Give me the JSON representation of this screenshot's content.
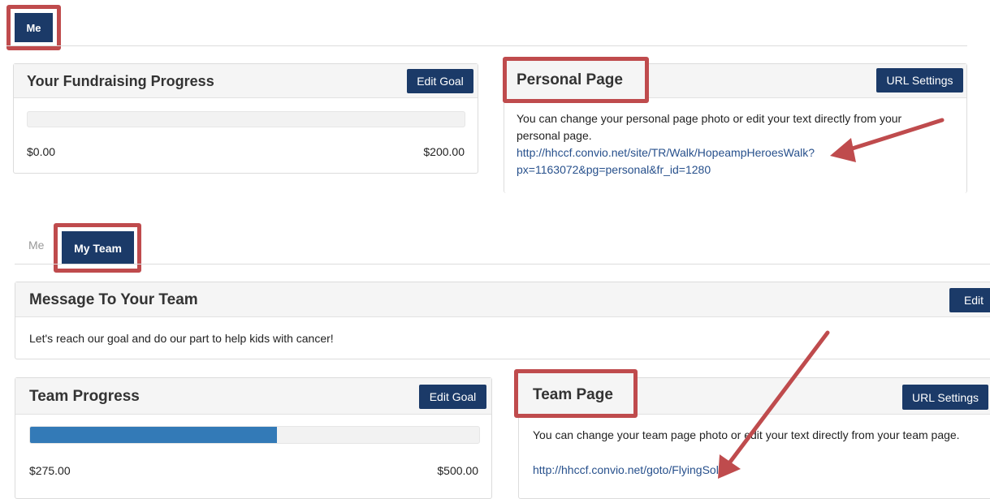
{
  "top": {
    "tab_me": "Me",
    "fundraising": {
      "title": "Your Fundraising Progress",
      "edit_label": "Edit Goal",
      "raised": "$0.00",
      "goal": "$200.00",
      "progress_fraction": 0
    },
    "personal_page": {
      "title": "Personal Page",
      "url_settings_label": "URL Settings",
      "description": "You can change your personal page photo or edit your text directly from your personal page.",
      "url_line1": "http://hhccf.convio.net/site/TR/Walk/HopeampHeroesWalk?",
      "url_line2": "px=1163072&pg=personal&fr_id=1280"
    }
  },
  "bottom": {
    "tab_me": "Me",
    "tab_my_team": "My Team",
    "message": {
      "title": "Message To Your Team",
      "edit_label": "Edit",
      "text": "Let's reach our goal and do our part to help kids with cancer!"
    },
    "team_progress": {
      "title": "Team Progress",
      "edit_label": "Edit Goal",
      "raised": "$275.00",
      "goal": "$500.00",
      "progress_fraction": 0.55
    },
    "team_page": {
      "title": "Team Page",
      "url_settings_label": "URL Settings",
      "description": "You can change your team page photo or edit your text directly from your team page.",
      "url": "http://hhccf.convio.net/goto/FlyingSolo"
    }
  },
  "colors": {
    "accent": "#1b3a68",
    "highlight": "#bf4b4d",
    "progress": "#337ab7",
    "link": "#27508c"
  }
}
